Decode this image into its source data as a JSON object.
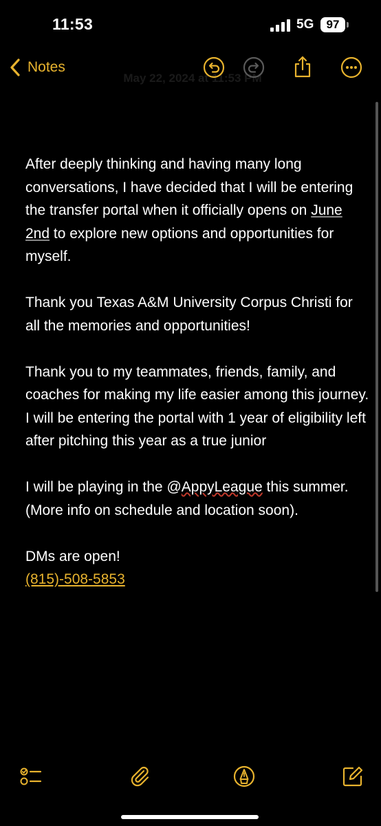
{
  "status_bar": {
    "time": "11:53",
    "network": "5G",
    "battery": "97"
  },
  "nav": {
    "back_label": "Notes",
    "title": "May 22, 2024 at 11:53 PM"
  },
  "note": {
    "p1_before": "After deeply thinking and having many long conversations, I have decided that I will be entering the transfer portal when it officially opens on ",
    "p1_link": "June 2nd",
    "p1_after": " to explore new options and opportunities for myself.",
    "p2": "Thank you Texas A&M University Corpus Christi for all the memories and opportunities!",
    "p3": "Thank you to my teammates, friends, family, and coaches for making my life easier among this journey. I will be entering the portal with 1 year of eligibility left after pitching this year as a true junior",
    "p4_before": "I will be playing in the @",
    "p4_misspelled": "AppyLeague",
    "p4_after": " this summer. (More info on schedule and location soon).",
    "p5": "DMs are open!",
    "phone": "(815)-508-5853"
  },
  "icons": {
    "back": "chevron-left-icon",
    "undo": "undo-icon",
    "redo": "redo-icon",
    "share": "share-icon",
    "more": "ellipsis-circle-icon",
    "checklist": "checklist-icon",
    "attach": "paperclip-icon",
    "markup": "markup-pen-icon",
    "compose": "compose-icon"
  },
  "colors": {
    "accent": "#e8b32e",
    "background": "#000000",
    "text": "#ffffff",
    "disabled": "#5a5a5a"
  }
}
